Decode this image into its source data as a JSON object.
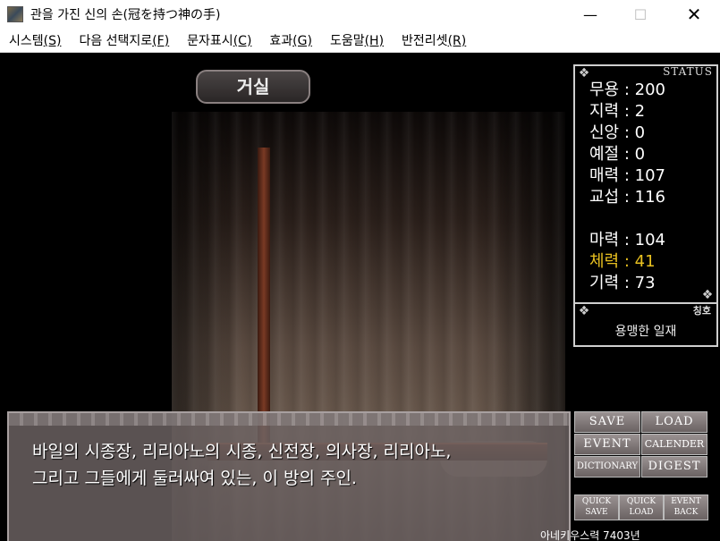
{
  "window": {
    "title": "관을 가진 신의 손(冠を持つ神の手)"
  },
  "menu": [
    {
      "label": "시스템",
      "key": "(S)"
    },
    {
      "label": "다음 선택지로",
      "key": "(F)"
    },
    {
      "label": "문자표시",
      "key": "(C)"
    },
    {
      "label": "효과",
      "key": "(G)"
    },
    {
      "label": "도움말",
      "key": "(H)"
    },
    {
      "label": "반전리셋",
      "key": "(R)"
    }
  ],
  "location": "거실",
  "status": {
    "title": "STATUS",
    "stats": [
      {
        "name": "무용",
        "value": "200"
      },
      {
        "name": "지력",
        "value": "2"
      },
      {
        "name": "신앙",
        "value": "0"
      },
      {
        "name": "예절",
        "value": "0"
      },
      {
        "name": "매력",
        "value": "107"
      },
      {
        "name": "교섭",
        "value": "116"
      },
      {
        "name": "마력",
        "value": "104"
      },
      {
        "name": "체력",
        "value": "41"
      },
      {
        "name": "기력",
        "value": "73"
      }
    ]
  },
  "epithet": {
    "label": "칭호",
    "value": "용맹한 일재"
  },
  "dialog": {
    "line1": "바일의 시종장, 리리아노의 시종, 신전장, 의사장, 리리아노,",
    "line2": "그리고 그들에게 둘러싸여 있는, 이 방의 주인."
  },
  "buttons": {
    "save": "SAVE",
    "load": "LOAD",
    "event": "EVENT",
    "calender": "CALENDER",
    "dictionary": "DICTIONARY",
    "digest": "DIGEST",
    "quick_save_1": "QUICK",
    "quick_save_2": "SAVE",
    "quick_load_1": "QUICK",
    "quick_load_2": "LOAD",
    "event_back_1": "EVENT",
    "event_back_2": "BACK"
  },
  "counter": "아네키우스력 7403년"
}
